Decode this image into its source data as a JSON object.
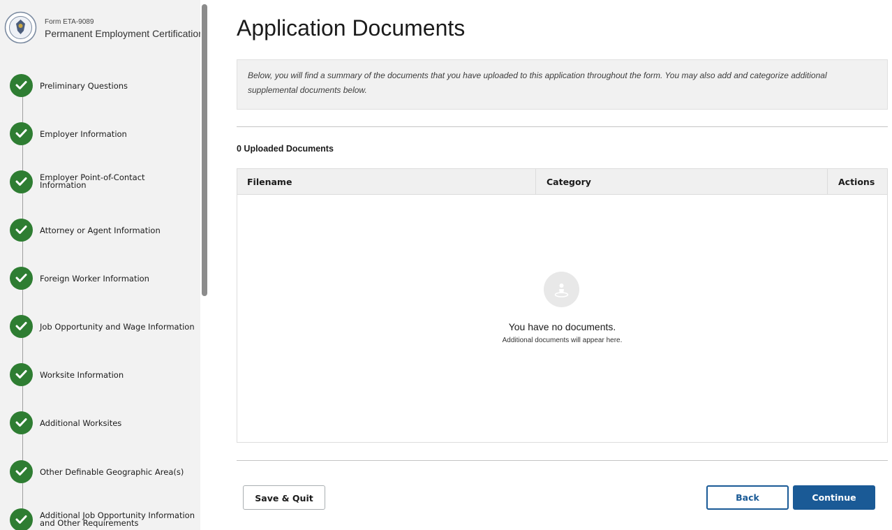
{
  "sidebar": {
    "form_number": "Form ETA-9089",
    "form_title": "Permanent Employment Certification",
    "steps": [
      {
        "label": "Preliminary Questions",
        "status": "complete"
      },
      {
        "label": "Employer Information",
        "status": "complete"
      },
      {
        "label": "Employer Point-of-Contact\nInformation",
        "status": "complete"
      },
      {
        "label": "Attorney or Agent Information",
        "status": "complete"
      },
      {
        "label": "Foreign Worker Information",
        "status": "complete"
      },
      {
        "label": "Job Opportunity and Wage Information",
        "status": "complete"
      },
      {
        "label": "Worksite Information",
        "status": "complete"
      },
      {
        "label": "Additional Worksites",
        "status": "complete"
      },
      {
        "label": "Other Definable Geographic Area(s)",
        "status": "complete"
      },
      {
        "label": "Additional Job Opportunity Information\nand Other Requirements",
        "status": "complete"
      }
    ]
  },
  "main": {
    "title": "Application Documents",
    "intro": "Below, you will find a summary of the documents that you have uploaded to this application throughout the form. You may also add and categorize additional supplemental documents below.",
    "uploaded_heading": "0 Uploaded Documents",
    "table": {
      "columns": [
        "Filename",
        "Category",
        "Actions"
      ],
      "rows": []
    },
    "empty_state": {
      "title": "You have no documents.",
      "subtitle": "Additional documents will appear here.",
      "icon": "empty-documents-icon"
    }
  },
  "actions": {
    "save_quit": "Save & Quit",
    "back": "Back",
    "continue": "Continue"
  },
  "colors": {
    "step_complete": "#2e7d32",
    "primary": "#1a5a96"
  }
}
